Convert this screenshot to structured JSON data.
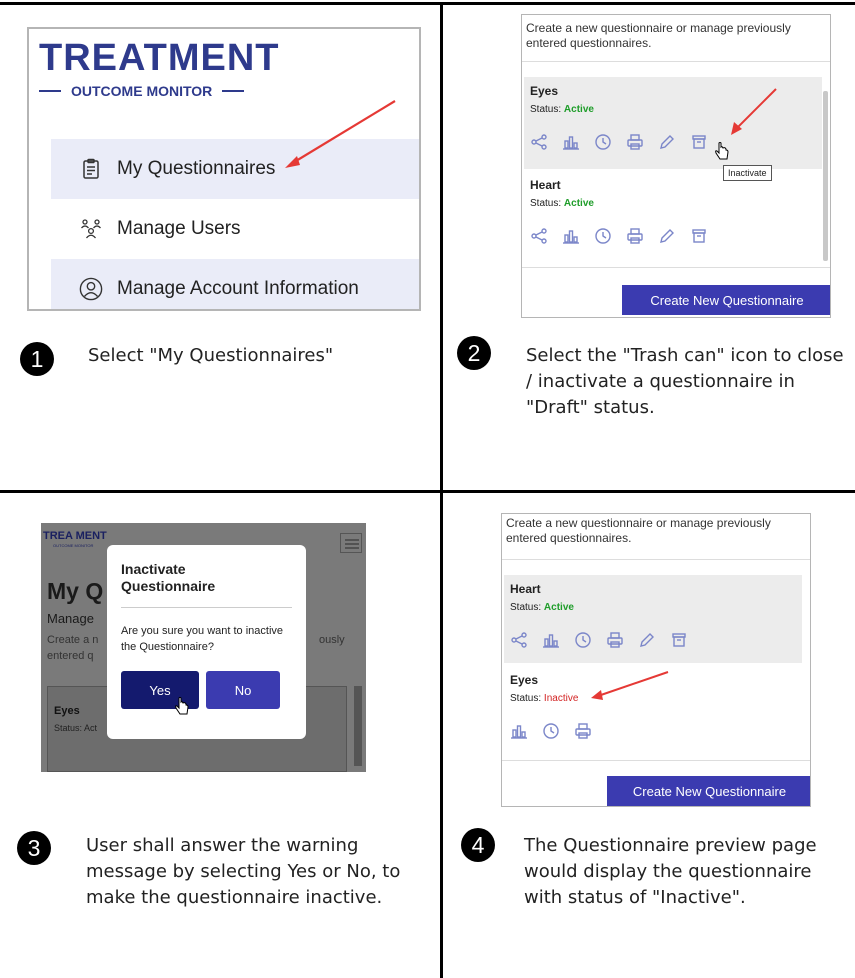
{
  "panel1": {
    "logo_word": "TREATMENT",
    "logo_sub": "OUTCOME MONITOR",
    "menu": [
      {
        "label": "My Questionnaires",
        "icon": "clipboard-icon"
      },
      {
        "label": "Manage Users",
        "icon": "users-icon"
      },
      {
        "label": "Manage Account Information",
        "icon": "account-icon"
      }
    ],
    "arrow_color": "#e53935"
  },
  "panel2": {
    "intro": "Create a new questionnaire or manage previously entered questionnaires.",
    "items": [
      {
        "name": "Eyes",
        "status_label": "Status:",
        "status": "Active"
      },
      {
        "name": "Heart",
        "status_label": "Status:",
        "status": "Active"
      }
    ],
    "tooltip": "Inactivate",
    "create_button": "Create New Questionnaire"
  },
  "panel3": {
    "bg_logo": "TREA MENT",
    "bg_logo_sub": "OUTCOME MONITOR",
    "bg_title": "My Q",
    "bg_sub": "Manage",
    "bg_line1_left": "Create a n",
    "bg_line1_right": "ously",
    "bg_line2": "entered q",
    "bg_card_name": "Eyes",
    "bg_card_status": "Status: Act",
    "modal_title": "Inactivate Questionnaire",
    "modal_message": "Are you sure you want to inactive the Questionnaire?",
    "yes": "Yes",
    "no": "No"
  },
  "panel4": {
    "intro": "Create a new questionnaire or manage previously entered questionnaires.",
    "items": [
      {
        "name": "Heart",
        "status_label": "Status:",
        "status": "Active"
      },
      {
        "name": "Eyes",
        "status_label": "Status:",
        "status": "Inactive"
      }
    ],
    "create_button": "Create New Questionnaire"
  },
  "steps": [
    {
      "number": "1",
      "text": "Select \"My Questionnaires\""
    },
    {
      "number": "2",
      "text": "Select the \"Trash can\" icon to close / inactivate a questionnaire in \"Draft\" status."
    },
    {
      "number": "3",
      "text": "User shall answer the warning message by selecting Yes or No, to make the questionnaire inactive."
    },
    {
      "number": "4",
      "text": "The Questionnaire preview page would display the questionnaire with status of \"Inactive\"."
    }
  ],
  "colors": {
    "brand": "#2e3a8c",
    "button": "#3b3bb0",
    "active": "#1f9d2a",
    "inactive": "#d32323",
    "icon": "#7b86c9"
  }
}
